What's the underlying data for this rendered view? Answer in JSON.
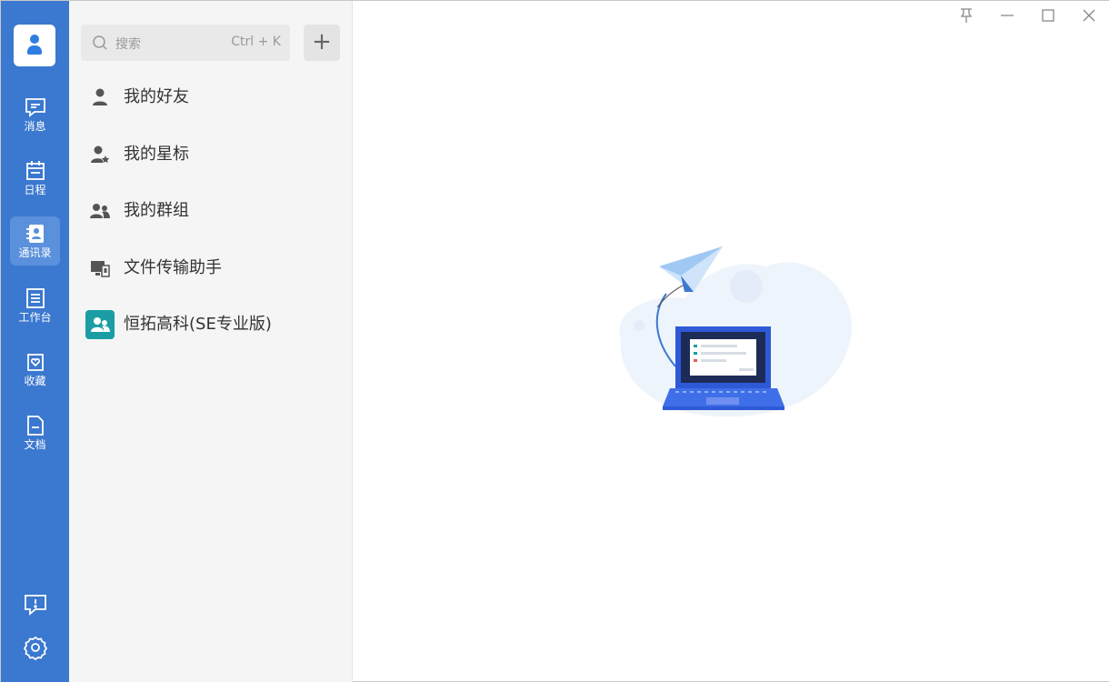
{
  "rail": {
    "items": [
      {
        "label": "消息",
        "icon": "message-icon"
      },
      {
        "label": "日程",
        "icon": "calendar-icon"
      },
      {
        "label": "通讯录",
        "icon": "contacts-icon",
        "active": true
      },
      {
        "label": "工作台",
        "icon": "workbench-icon"
      },
      {
        "label": "收藏",
        "icon": "favorites-icon"
      },
      {
        "label": "文档",
        "icon": "document-icon"
      }
    ],
    "bottom": [
      {
        "icon": "feedback-icon"
      },
      {
        "icon": "settings-icon"
      }
    ],
    "accent": "#3b78cf"
  },
  "search": {
    "placeholder": "搜索",
    "shortcut": "Ctrl + K"
  },
  "add_button": "+",
  "contacts": {
    "items": [
      {
        "label": "我的好友",
        "icon": "person-icon"
      },
      {
        "label": "我的星标",
        "icon": "starred-person-icon"
      },
      {
        "label": "我的群组",
        "icon": "group-icon"
      },
      {
        "label": "文件传输助手",
        "icon": "file-transfer-icon"
      },
      {
        "label": "恒拓高科(SE专业版)",
        "icon": "organization-icon"
      }
    ]
  },
  "window": {
    "controls": [
      "pin-icon",
      "minimize-icon",
      "maximize-icon",
      "close-icon"
    ]
  }
}
